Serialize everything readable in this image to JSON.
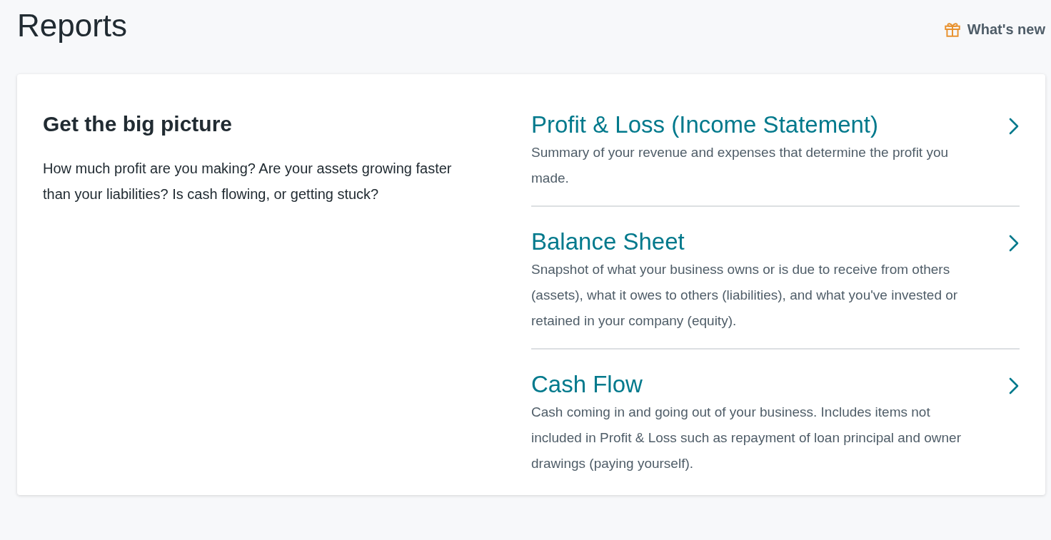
{
  "page": {
    "title": "Reports",
    "whats_new": "What's new"
  },
  "intro": {
    "heading": "Get the big picture",
    "text": "How much profit are you making? Are your assets growing faster than your liabilities? Is cash flowing, or getting stuck?"
  },
  "reports": [
    {
      "title": "Profit & Loss (Income Statement)",
      "description": "Summary of your revenue and expenses that determine the profit you made."
    },
    {
      "title": "Balance Sheet",
      "description": "Snapshot of what your business owns or is due to receive from others (assets), what it owes to others (liabilities), and what you've invested or retained in your company (equity)."
    },
    {
      "title": "Cash Flow",
      "description": "Cash coming in and going out of your business. Includes items not included in Profit & Loss such as repayment of loan principal and owner drawings (paying yourself)."
    }
  ]
}
